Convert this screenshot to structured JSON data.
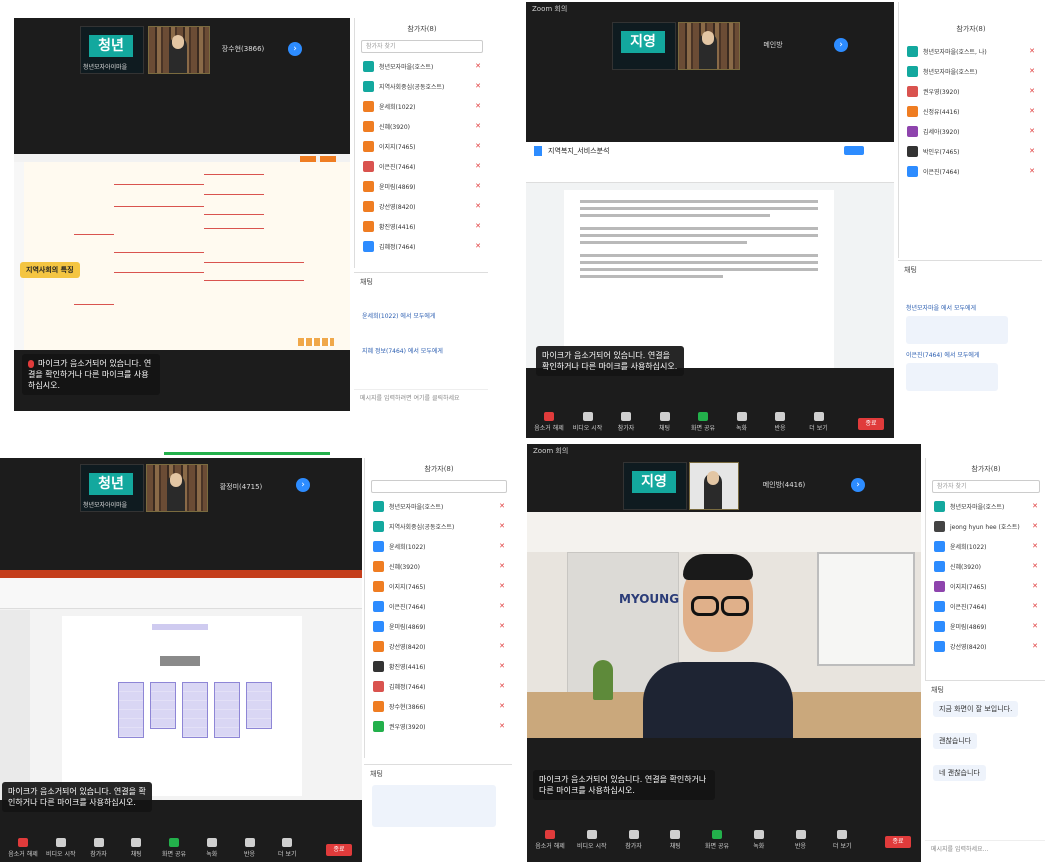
{
  "screens": {
    "top_left": {
      "tile_name": "청년",
      "tile_sub": "청년모자아이마을",
      "name_tile": "장수현(3866)",
      "panel_title": "참가자(8)",
      "search_placeholder": "참가자 찾기",
      "participants": [
        {
          "name": "청년모자마을(호스트)",
          "color": "#13a89e"
        },
        {
          "name": "지역사회중심(공동호스트)",
          "color": "#13a89e"
        },
        {
          "name": "윤세희(1022)",
          "color": "#ef7d22"
        },
        {
          "name": "신혜(3920)",
          "color": "#ef7d22"
        },
        {
          "name": "이지지(7465)",
          "color": "#ef7d22"
        },
        {
          "name": "이은진(7464)",
          "color": "#d9534f"
        },
        {
          "name": "윤미림(4869)",
          "color": "#ef7d22"
        },
        {
          "name": "강선영(8420)",
          "color": "#ef7d22"
        },
        {
          "name": "황진영(4416)",
          "color": "#ef7d22"
        },
        {
          "name": "김혜정(7464)",
          "color": "#2d8cff"
        }
      ],
      "chat_title": "채팅",
      "chat_msgs": [
        "윤세희(1022) 에서 모두에게",
        "지혜 정보(7464) 에서 모두에게"
      ],
      "chat_input": "메시지를 입력하려면 여기를 클릭하세요",
      "mindmap_root": "지역사회의 특징",
      "notice": "마이크가 음소거되어 있습니다. 연결을 확인하거나 다른 마이크를 사용하십시오.",
      "toolbar": [
        "음소거 해제",
        "비디오 시작",
        "참가자",
        "채팅",
        "화면 공유",
        "녹화",
        "반응",
        "더 보기"
      ],
      "end": "종료"
    },
    "top_right": {
      "title": "Zoom 회의",
      "tile_name": "지영",
      "name_tile": "메인방",
      "panel_title": "참가자(8)",
      "participants": [
        {
          "name": "청년모자마을(호스트, 나)",
          "color": "#13a89e"
        },
        {
          "name": "청년모자마을(호스트)",
          "color": "#13a89e"
        },
        {
          "name": "권우영(3920)",
          "color": "#d9534f"
        },
        {
          "name": "신정유(4416)",
          "color": "#ef7d22"
        },
        {
          "name": "김세아(3920)",
          "color": "#8e44ad"
        },
        {
          "name": "박인우(7465)",
          "color": "#333333"
        },
        {
          "name": "이은진(7464)",
          "color": "#2d8cff"
        }
      ],
      "chat_title": "채팅",
      "chat_msgs": [
        "청년모자마을 에서 모두에게",
        "이은진(7464) 에서 모두에게"
      ],
      "doc_title": "지역복지_서비스분석",
      "notice": "마이크가 음소거되어 있습니다. 연결을 확인하거나 다른 마이크를 사용하십시오.",
      "toolbar": [
        "음소거 해제",
        "비디오 시작",
        "참가자",
        "채팅",
        "화면 공유",
        "녹화",
        "반응",
        "더 보기"
      ],
      "end": "종료"
    },
    "bottom_left": {
      "tile_name": "청년",
      "tile_sub": "청년모자아이마을",
      "name_tile": "황정미(4715)",
      "panel_title": "참가자(8)",
      "participants": [
        {
          "name": "청년모자마을(호스트)",
          "color": "#13a89e"
        },
        {
          "name": "지역사회중심(공동호스트)",
          "color": "#13a89e"
        },
        {
          "name": "윤세희(1022)",
          "color": "#2d8cff"
        },
        {
          "name": "신혜(3920)",
          "color": "#ef7d22"
        },
        {
          "name": "이지지(7465)",
          "color": "#ef7d22"
        },
        {
          "name": "이은진(7464)",
          "color": "#2d8cff"
        },
        {
          "name": "윤미림(4869)",
          "color": "#2d8cff"
        },
        {
          "name": "강선영(8420)",
          "color": "#ef7d22"
        },
        {
          "name": "황진영(4416)",
          "color": "#333333"
        },
        {
          "name": "김혜정(7464)",
          "color": "#d9534f"
        },
        {
          "name": "장수현(3866)",
          "color": "#ef7d22"
        },
        {
          "name": "권우영(3920)",
          "color": "#23b04b"
        }
      ],
      "chat_title": "채팅",
      "notice": "마이크가 음소거되어 있습니다. 연결을 확인하거나 다른 마이크를 사용하십시오.",
      "toolbar": [
        "음소거 해제",
        "비디오 시작",
        "참가자",
        "채팅",
        "화면 공유",
        "녹화",
        "반응",
        "더 보기"
      ],
      "end": "종료"
    },
    "bottom_right": {
      "title": "Zoom 회의",
      "tile_name": "지영",
      "name_tile": "메인방(4416)",
      "brand": "MYOUNG",
      "panel_title": "참가자(8)",
      "search_placeholder": "참가자 찾기",
      "participants": [
        {
          "name": "청년모자마을(호스트)",
          "color": "#13a89e"
        },
        {
          "name": "jeong hyun hee (호스트)",
          "color": "#444444"
        },
        {
          "name": "윤세희(1022)",
          "color": "#2d8cff"
        },
        {
          "name": "신혜(3920)",
          "color": "#2d8cff"
        },
        {
          "name": "이지지(7465)",
          "color": "#8e44ad"
        },
        {
          "name": "이은진(7464)",
          "color": "#2d8cff"
        },
        {
          "name": "윤미림(4869)",
          "color": "#2d8cff"
        },
        {
          "name": "강선영(8420)",
          "color": "#2d8cff"
        }
      ],
      "chat_title": "채팅",
      "chat_bubbles": [
        "지금 화면이 잘 보입니다.",
        "괜찮습니다",
        "네 괜찮습니다"
      ],
      "chat_input": "메시지를 입력하세요...",
      "notice": "마이크가 음소거되어 있습니다. 연결을 확인하거나 다른 마이크를 사용하십시오.",
      "toolbar": [
        "음소거 해제",
        "비디오 시작",
        "참가자",
        "채팅",
        "화면 공유",
        "녹화",
        "반응",
        "더 보기"
      ],
      "end": "종료"
    }
  }
}
